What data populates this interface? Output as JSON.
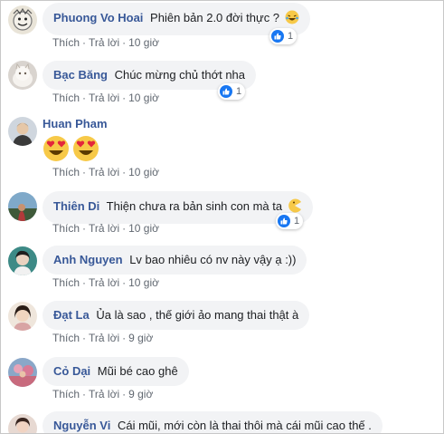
{
  "actions": {
    "like": "Thích",
    "reply": "Trả lời"
  },
  "comments": [
    {
      "name": "Phuong Vo Hoai",
      "text": "Phiên bản 2.0 đời thực ?",
      "emoji": "laughing-emoji",
      "time": "10 giờ",
      "reactions": "1"
    },
    {
      "name": "Bạc Băng",
      "text": "Chúc mừng chủ thớt nha",
      "time": "10 giờ",
      "reactions": "1"
    },
    {
      "name": "Huan Pham",
      "text": "",
      "emoji": "heart-eyes-emoji x2",
      "time": "10 giờ"
    },
    {
      "name": "Thiên Di",
      "text": "Thiện chưa ra bản sinh con mà ta",
      "emoji": "pacman-emoji",
      "time": "10 giờ",
      "reactions": "1"
    },
    {
      "name": "Anh Nguyen",
      "text": "Lv bao nhiêu có nv này vậy ạ :))",
      "time": "10 giờ"
    },
    {
      "name": "Đạt La",
      "text": "Ủa là sao , thế giới ảo mang thai thật à",
      "time": "9 giờ"
    },
    {
      "name": "Cỏ Dại",
      "text": "Mũi bé cao ghê",
      "time": "9 giờ"
    },
    {
      "name": "Nguyễn Vi",
      "text": "Cái mũi, mới còn là thai thôi mà cái mũi cao thế .",
      "time": ""
    }
  ]
}
